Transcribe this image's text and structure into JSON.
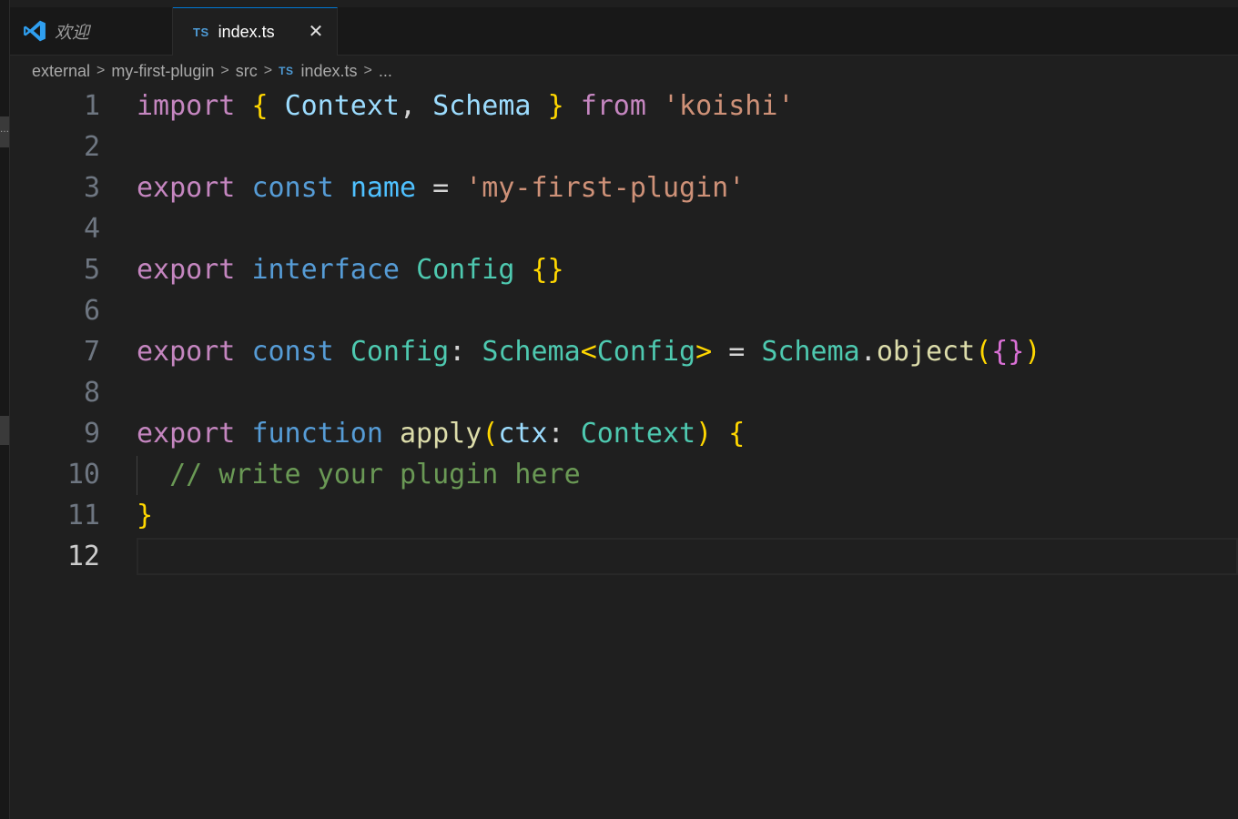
{
  "tabs": [
    {
      "label": "欢迎",
      "icon": "vscode-logo-icon",
      "active": false
    },
    {
      "label": "index.ts",
      "badge": "TS",
      "active": true
    }
  ],
  "breadcrumb": {
    "items": [
      "external",
      "my-first-plugin",
      "src"
    ],
    "file_badge": "TS",
    "file": "index.ts",
    "ellipsis": "..."
  },
  "editor": {
    "current_line": 12,
    "lines": [
      {
        "n": "1",
        "tokens": [
          [
            "import",
            "kw-purple"
          ],
          [
            " ",
            "plain"
          ],
          [
            "{",
            "brace1"
          ],
          [
            " ",
            "plain"
          ],
          [
            "Context",
            "param"
          ],
          [
            ",",
            "plain"
          ],
          [
            " ",
            "plain"
          ],
          [
            "Schema",
            "param"
          ],
          [
            " ",
            "plain"
          ],
          [
            "}",
            "brace1"
          ],
          [
            " ",
            "plain"
          ],
          [
            "from",
            "kw-purple"
          ],
          [
            " ",
            "plain"
          ],
          [
            "'koishi'",
            "str"
          ]
        ]
      },
      {
        "n": "2",
        "tokens": []
      },
      {
        "n": "3",
        "tokens": [
          [
            "export",
            "kw-purple"
          ],
          [
            " ",
            "plain"
          ],
          [
            "const",
            "kw-blue"
          ],
          [
            " ",
            "plain"
          ],
          [
            "name",
            "var"
          ],
          [
            " = ",
            "plain"
          ],
          [
            "'my-first-plugin'",
            "str"
          ]
        ]
      },
      {
        "n": "4",
        "tokens": []
      },
      {
        "n": "5",
        "tokens": [
          [
            "export",
            "kw-purple"
          ],
          [
            " ",
            "plain"
          ],
          [
            "interface",
            "kw-blue"
          ],
          [
            " ",
            "plain"
          ],
          [
            "Config",
            "type"
          ],
          [
            " ",
            "plain"
          ],
          [
            "{}",
            "brace1"
          ]
        ]
      },
      {
        "n": "6",
        "tokens": []
      },
      {
        "n": "7",
        "tokens": [
          [
            "export",
            "kw-purple"
          ],
          [
            " ",
            "plain"
          ],
          [
            "const",
            "kw-blue"
          ],
          [
            " ",
            "plain"
          ],
          [
            "Config",
            "type"
          ],
          [
            ": ",
            "plain"
          ],
          [
            "Schema",
            "type"
          ],
          [
            "<",
            "brace1"
          ],
          [
            "Config",
            "type"
          ],
          [
            ">",
            "brace1"
          ],
          [
            " = ",
            "plain"
          ],
          [
            "Schema",
            "type"
          ],
          [
            ".",
            "plain"
          ],
          [
            "object",
            "fn"
          ],
          [
            "(",
            "brace1"
          ],
          [
            "{}",
            "brace2"
          ],
          [
            ")",
            "brace1"
          ]
        ]
      },
      {
        "n": "8",
        "tokens": []
      },
      {
        "n": "9",
        "tokens": [
          [
            "export",
            "kw-purple"
          ],
          [
            " ",
            "plain"
          ],
          [
            "function",
            "kw-blue"
          ],
          [
            " ",
            "plain"
          ],
          [
            "apply",
            "fn"
          ],
          [
            "(",
            "brace1"
          ],
          [
            "ctx",
            "param"
          ],
          [
            ": ",
            "plain"
          ],
          [
            "Context",
            "type"
          ],
          [
            ")",
            "brace1"
          ],
          [
            " ",
            "plain"
          ],
          [
            "{",
            "brace1"
          ]
        ]
      },
      {
        "n": "10",
        "tokens": [
          [
            "  ",
            "plain"
          ],
          [
            "// write your plugin here",
            "comment"
          ]
        ]
      },
      {
        "n": "11",
        "tokens": [
          [
            "}",
            "brace1"
          ]
        ]
      },
      {
        "n": "12",
        "tokens": []
      }
    ]
  }
}
